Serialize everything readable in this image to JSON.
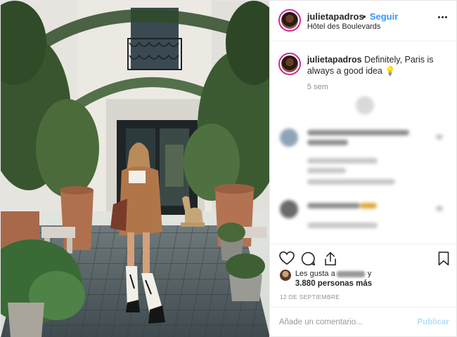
{
  "header": {
    "username": "julietapadros",
    "separator": "•",
    "follow_label": "Seguir",
    "location": "Hôtel des Boulevards"
  },
  "caption": {
    "username": "julietapadros",
    "text": "Definitely, Paris is always a good idea",
    "emoji": "💡",
    "time": "5 sem"
  },
  "likes": {
    "prefix": "Les gusta a",
    "suffix": "y",
    "count_text": "3.880 personas más"
  },
  "date": "12 DE SEPTIEMBRE",
  "comment_box": {
    "placeholder": "Añade un comentario...",
    "publish_label": "Publicar"
  },
  "colors": {
    "link_blue": "#3897f0",
    "publish_disabled": "#b2dffc",
    "muted_gray": "#8e8e8e",
    "story_ring": "#d6249f"
  },
  "icons": [
    "more-options-icon",
    "heart-icon",
    "comment-icon",
    "share-icon",
    "bookmark-icon"
  ]
}
